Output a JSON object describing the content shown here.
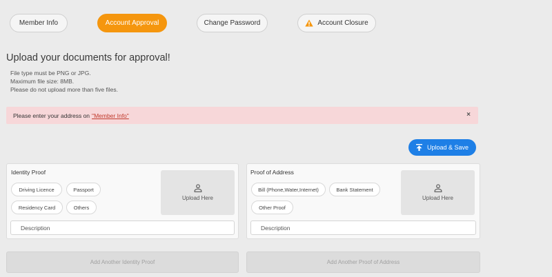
{
  "tabs": {
    "member_info": "Member Info",
    "account_approval": "Account Approval",
    "change_password": "Change Password",
    "account_closure": "Account Closure"
  },
  "heading": "Upload your documents for approval!",
  "hints": [
    "File type must be PNG or JPG.",
    "Maximum file size: 8MB.",
    "Please do not upload more than five files."
  ],
  "alert": {
    "text": "Please enter your address on",
    "link": "\"Member Info\"",
    "close": "×"
  },
  "upload_save": "Upload & Save",
  "identity": {
    "title": "Identity Proof",
    "chips": [
      "Driving Licence",
      "Passport",
      "Residency Card",
      "Others"
    ],
    "dropzone": "Upload Here",
    "description": "Description"
  },
  "address": {
    "title": "Proof of Address",
    "chips": [
      "Bill (Phone,Water,Internet)",
      "Bank Statement",
      "Other Proof"
    ],
    "dropzone": "Upload Here",
    "description": "Description"
  },
  "add_identity": "Add Another Identity Proof",
  "add_address": "Add Another Proof of Address",
  "colors": {
    "accent_orange": "#f5960e",
    "primary_blue": "#1e7fe6",
    "alert_bg": "#f7d7d9",
    "warning_icon": "#f5960e"
  },
  "icons": {
    "closure_tab": "warning-icon",
    "upload_save": "upload-icon",
    "dropzone": "user-icon"
  }
}
